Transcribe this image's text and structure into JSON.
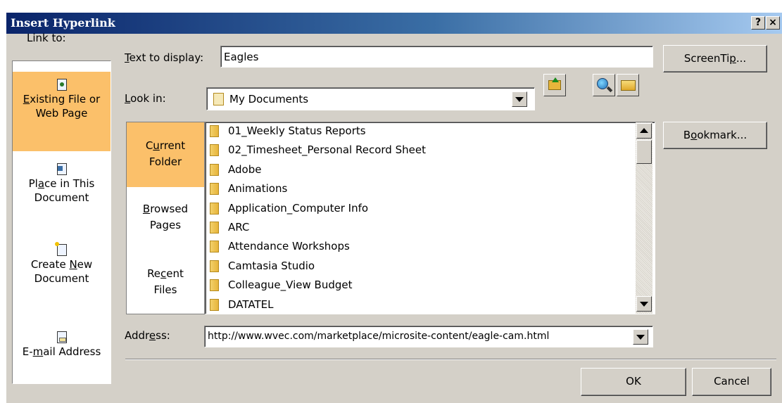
{
  "title": "Insert Hyperlink",
  "title_buttons": {
    "help": "?",
    "close": "×"
  },
  "link_to": {
    "heading": "Link to:",
    "items": [
      {
        "pre": "",
        "u": "E",
        "post": "xisting File or",
        "line2": "Web Page",
        "icon": "web-page-icon",
        "selected": true
      },
      {
        "pre": "Pl",
        "u": "a",
        "post": "ce in This",
        "line2": "Document",
        "icon": "place-in-document-icon",
        "selected": false
      },
      {
        "pre": "Create ",
        "u": "N",
        "post": "ew",
        "line2": "Document",
        "icon": "new-document-icon",
        "selected": false
      },
      {
        "pre": "E-",
        "u": "m",
        "post": "ail Address",
        "line2": "",
        "icon": "email-icon",
        "selected": false
      }
    ]
  },
  "text_to_display": {
    "pre": "",
    "u": "T",
    "post": "ext to display:",
    "value": "Eagles"
  },
  "screentip": {
    "pre": "ScreenTi",
    "u": "p",
    "post": "..."
  },
  "look_in": {
    "pre": "",
    "u": "L",
    "post": "ook in:",
    "value": "My Documents"
  },
  "browse_nav": [
    {
      "pre": "C",
      "u": "u",
      "post": "rrent",
      "line2": "Folder",
      "selected": true
    },
    {
      "pre": "",
      "u": "B",
      "post": "rowsed",
      "line2": "Pages",
      "selected": false
    },
    {
      "pre": "Re",
      "u": "c",
      "post": "ent",
      "line2": "Files",
      "selected": false
    }
  ],
  "files": [
    "01_Weekly Status Reports",
    "02_Timesheet_Personal Record Sheet",
    "Adobe",
    "Animations",
    "Application_Computer Info",
    "ARC",
    "Attendance Workshops",
    "Camtasia Studio",
    "Colleague_View Budget",
    "DATATEL"
  ],
  "bookmark": {
    "pre": "B",
    "u": "o",
    "post": "okmark..."
  },
  "address": {
    "pre": "Addr",
    "u": "e",
    "post": "ss:",
    "value": "http://www.wvec.com/marketplace/microsite-content/eagle-cam.html"
  },
  "ok_label": "OK",
  "cancel_label": "Cancel"
}
